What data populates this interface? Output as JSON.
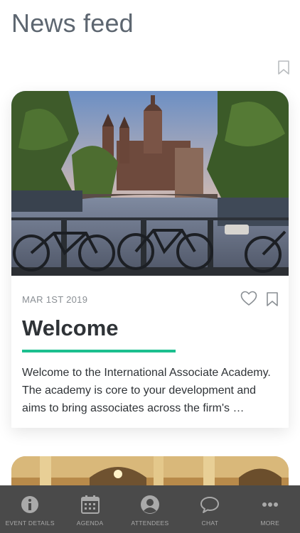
{
  "header": {
    "title": "News feed"
  },
  "feed": {
    "cards": [
      {
        "date": "MAR 1ST 2019",
        "title": "Welcome",
        "excerpt": "Welcome to the International Associate Academy. The academy is core to your development and aims to bring associates across the firm's …",
        "image": "amsterdam-canal-photo"
      },
      {
        "image": "hotel-interior-photo"
      }
    ]
  },
  "tabbar": {
    "items": [
      {
        "label": "EVENT DETAILS",
        "icon": "info-icon"
      },
      {
        "label": "AGENDA",
        "icon": "calendar-icon"
      },
      {
        "label": "ATTENDEES",
        "icon": "person-icon"
      },
      {
        "label": "CHAT",
        "icon": "chat-bubble-icon"
      },
      {
        "label": "MORE",
        "icon": "more-dots-icon"
      }
    ]
  },
  "colors": {
    "accent": "#1cbf8f",
    "tabbar": "#4a4a4a",
    "title": "#5d6670"
  }
}
